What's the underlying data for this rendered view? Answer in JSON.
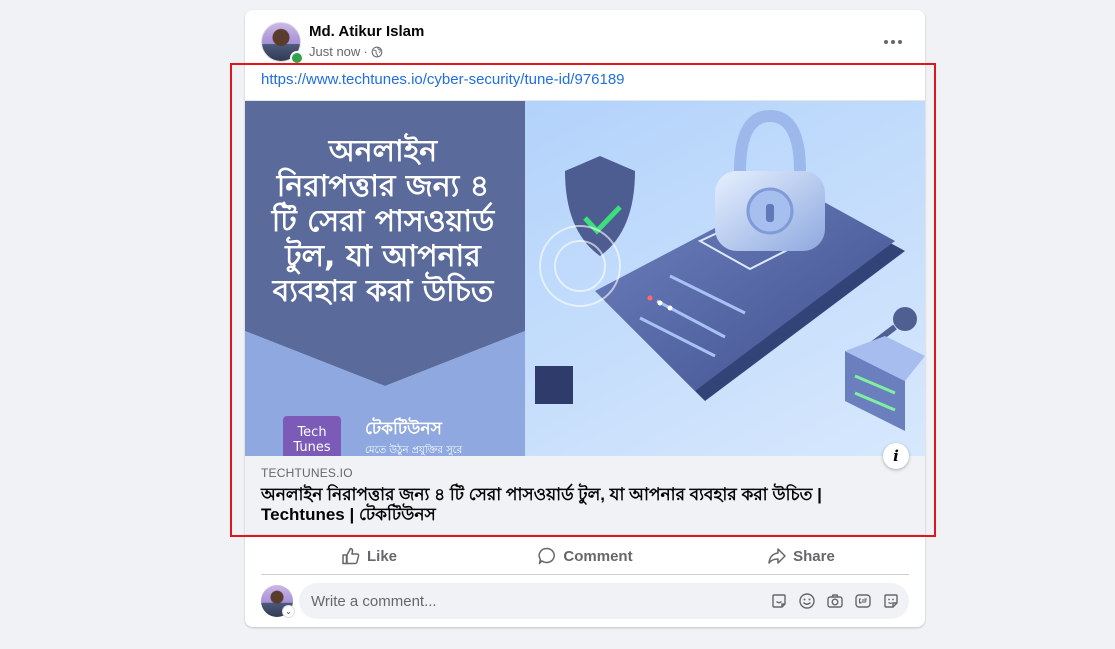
{
  "post": {
    "author_name": "Md. Atikur Islam",
    "timestamp": "Just now",
    "separator": "·",
    "privacy_icon": "globe-icon",
    "more_icon": "more-horizontal-icon",
    "link_url": "https://www.techtunes.io/cyber-security/tune-id/976189"
  },
  "preview": {
    "image_heading": [
      "অনলাইন",
      "নিরাপত্তার জন্য ৪",
      "টি সেরা পাসওয়ার্ড",
      "টুল, যা আপনার",
      "ব্যবহার করা উচিত"
    ],
    "brand_logo_line1": "Tech",
    "brand_logo_line2": "Tunes",
    "brand_name_bn": "টেকটিউনস",
    "brand_tagline_bn": "মেতে উঠুন প্রযুক্তির সুরে",
    "info_icon_label": "i",
    "domain": "TECHTUNES.IO",
    "title": "অনলাইন নিরাপত্তার জন্য ৪ টি সেরা পাসওয়ার্ড টুল, যা আপনার ব্যবহার করা উচিত | Techtunes | টেকটিউনস"
  },
  "actions": {
    "like_label": "Like",
    "comment_label": "Comment",
    "share_label": "Share"
  },
  "comment_box": {
    "placeholder": "Write a comment...",
    "avatar_chevron": "⌄",
    "tools": [
      "sticker-icon",
      "emoji-icon",
      "camera-icon",
      "gif-icon",
      "avatar-sticker-icon"
    ]
  },
  "colors": {
    "link": "#216fdb",
    "highlight": "#e0161f",
    "online": "#31a24c",
    "image_left_panel": "#5a6a9a",
    "image_right_bg": "#bcd8fb"
  }
}
